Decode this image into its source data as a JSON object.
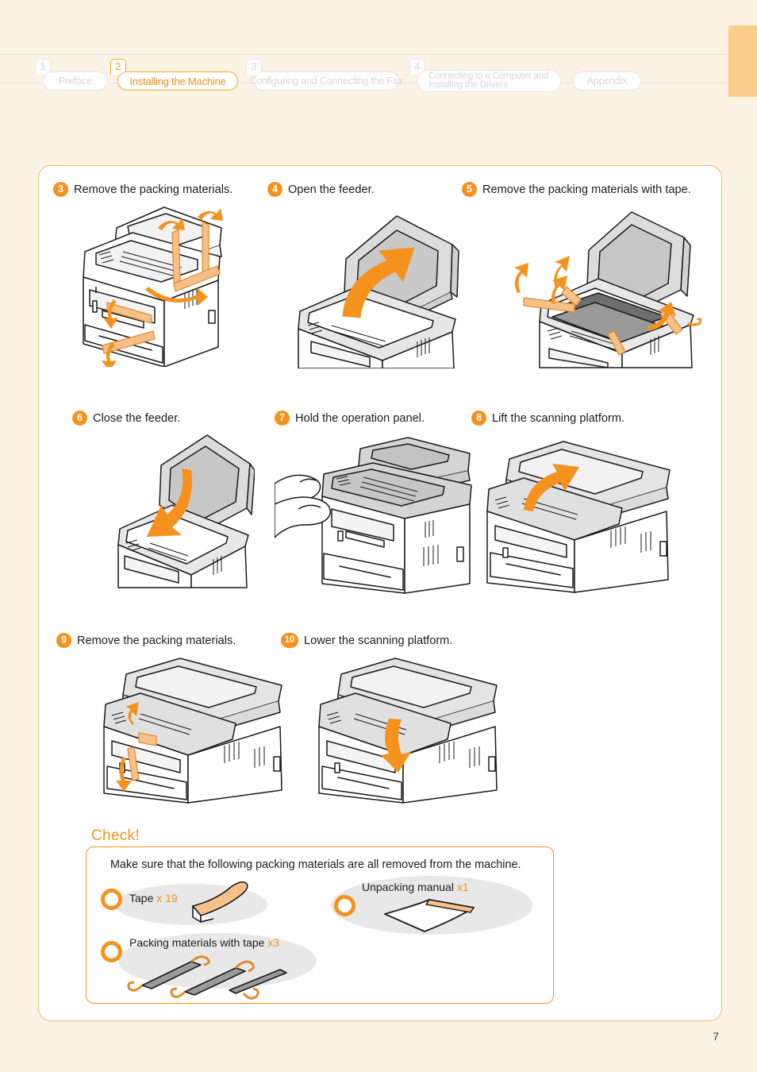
{
  "nav": {
    "tabs": [
      {
        "number": "1",
        "label": "Preface",
        "active": false
      },
      {
        "number": "2",
        "label": "Installing the Machine",
        "active": true
      },
      {
        "number": "3",
        "label": "Configuring and Connecting the Fax",
        "active": false
      },
      {
        "number": "4",
        "label": "Connecting to a Computer and",
        "label2": "Installing the Drivers",
        "active": false
      },
      {
        "number": "",
        "label": "Appendix",
        "active": false
      }
    ],
    "accent_color": "#f5921e",
    "inactive_color": "#d7d7d7"
  },
  "steps": [
    {
      "number": "3",
      "text": "Remove the packing materials.",
      "figure": "printer-remove-packing-tape"
    },
    {
      "number": "4",
      "text": "Open the feeder.",
      "figure": "printer-open-feeder"
    },
    {
      "number": "5",
      "text": "Remove the packing materials with tape.",
      "figure": "printer-remove-packing-with-tape"
    },
    {
      "number": "6",
      "text": "Close the feeder.",
      "figure": "printer-close-feeder"
    },
    {
      "number": "7",
      "text": "Hold the operation panel.",
      "figure": "printer-hold-operation-panel"
    },
    {
      "number": "8",
      "text": "Lift the scanning platform.",
      "figure": "printer-lift-scanning-platform"
    },
    {
      "number": "9",
      "text": "Remove the packing materials.",
      "figure": "printer-remove-packing-inside"
    },
    {
      "number": "10",
      "text": "Lower the scanning platform.",
      "figure": "printer-lower-scanning-platform"
    }
  ],
  "check": {
    "title": "Check!",
    "lead": "Make sure that the following packing materials are all removed from the machine.",
    "items": [
      {
        "label": "Tape",
        "qty": "x 19",
        "icon": "tape-strip-icon"
      },
      {
        "label": "Unpacking manual",
        "qty": "x1",
        "icon": "manual-sheet-icon"
      },
      {
        "label": "Packing materials with tape",
        "qty": "x3",
        "icon": "packing-bars-icon"
      }
    ]
  },
  "footer": {
    "page_number": "7"
  }
}
